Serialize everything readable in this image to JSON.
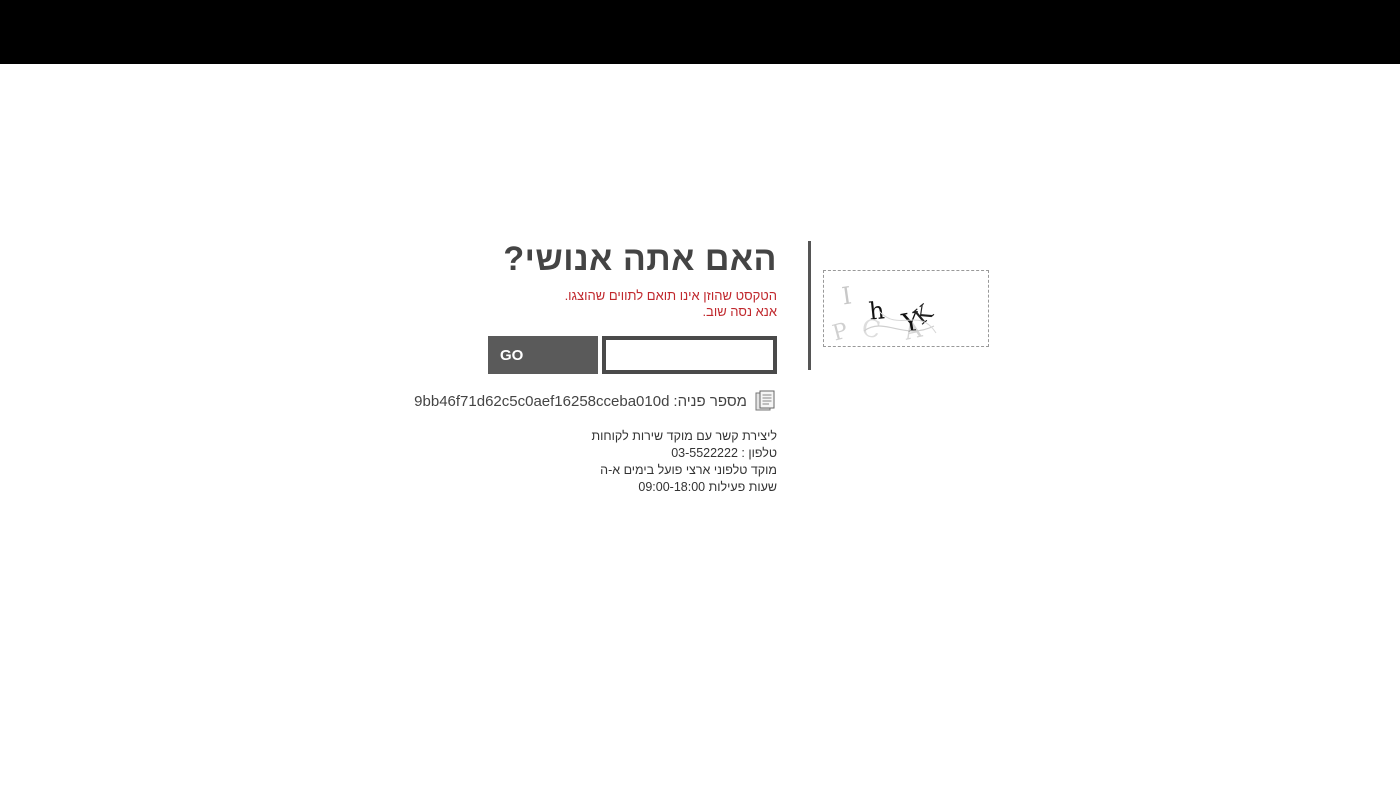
{
  "page": {
    "title": "האם אתה אנושי?",
    "error_line1": "הטקסט שהוזן אינו תואם לתווים שהוצגו.",
    "error_line2": "אנא נסה שוב."
  },
  "form": {
    "input_value": "",
    "input_placeholder": "",
    "go_label": "GO"
  },
  "reference": {
    "label": "מספר פניה:",
    "value": "9bb46f71d62c5c0aef16258cceba010d",
    "icon": "document-icon"
  },
  "contact": {
    "lines": [
      "ליצירת קשר עם מוקד שירות לקוחות",
      "טלפון : 03-5522222",
      "מוקד טלפוני ארצי פועל בימים א-ה",
      "שעות פעילות 09:00-18:00"
    ]
  },
  "captcha": {
    "glyphs": [
      "I",
      "P",
      "h",
      "Y",
      "K",
      "C",
      "A"
    ]
  },
  "colors": {
    "top_bar": "#000000",
    "title": "#444444",
    "error": "#c0282d",
    "button": "#5a5a5a"
  }
}
